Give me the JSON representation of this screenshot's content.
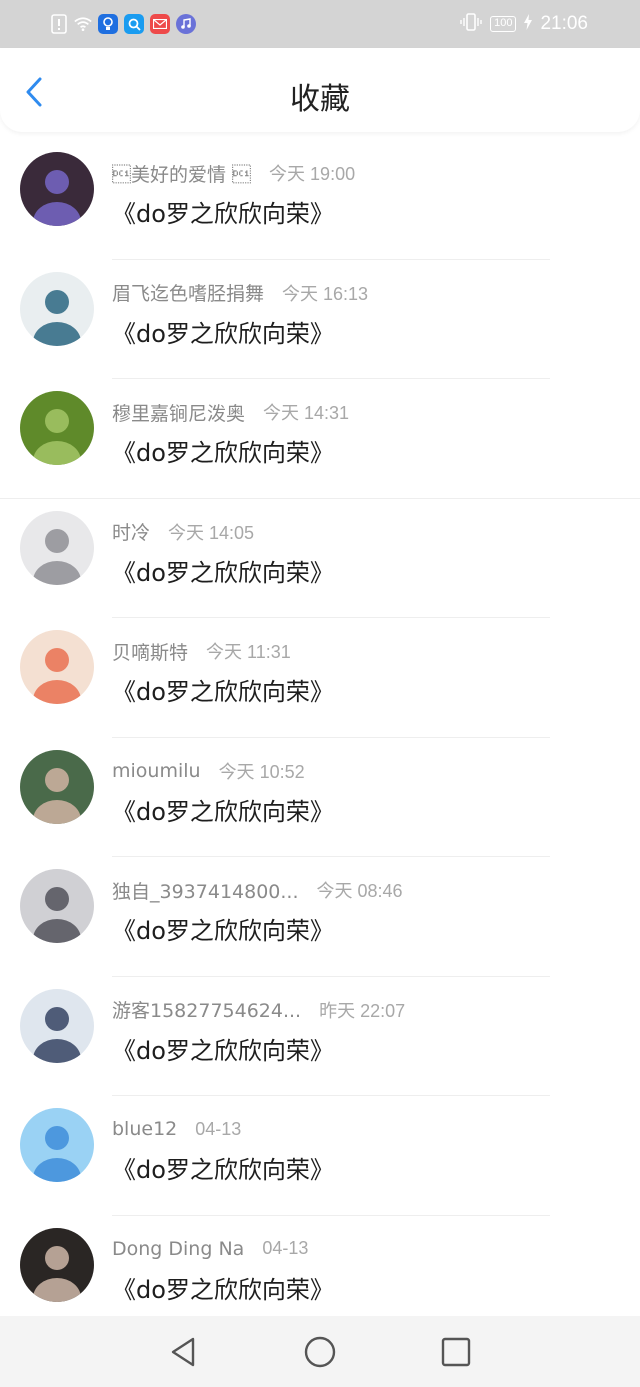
{
  "status_bar": {
    "time": "21:06",
    "battery": "100",
    "left_icons": [
      "alert-icon",
      "wifi-icon",
      "bulb-app-icon",
      "search-app-icon",
      "huawei-mail-icon",
      "music-app-icon"
    ],
    "right_icons": [
      "vibrate-icon",
      "battery-icon",
      "charging-icon"
    ]
  },
  "header": {
    "title": "收藏",
    "back_icon": "chevron-left-icon",
    "accent": "#2f8bef"
  },
  "favorites": [
    {
      "name": "\u0011美好的爱情 \u0011",
      "time": "今天 19:00",
      "content": "《do罗之欣欣向荣》",
      "avatar": [
        "#3a2a3a",
        "#7a6ad0"
      ]
    },
    {
      "name": "眉飞迄色嗜胫捐舞",
      "time": "今天 16:13",
      "content": "《do罗之欣欣向荣》",
      "avatar": [
        "#e9eef0",
        "#1f5e7a"
      ]
    },
    {
      "name": "穆里嘉锏尼泼奥",
      "time": "今天 14:31",
      "content": "《do罗之欣欣向荣》",
      "avatar": [
        "#5f8a2a",
        "#a8c86a"
      ]
    },
    {
      "name": "时冷",
      "time": "今天 14:05",
      "content": "《do罗之欣欣向荣》",
      "avatar": [
        "#e8e8ea",
        "#8a8a90"
      ]
    },
    {
      "name": "贝嘀斯特",
      "time": "今天 11:31",
      "content": "《do罗之欣欣向荣》",
      "avatar": [
        "#f4e0d2",
        "#e86a4a"
      ]
    },
    {
      "name": "mioumilu",
      "time": "今天 10:52",
      "content": "《do罗之欣欣向荣》",
      "avatar": [
        "#4a6a4a",
        "#d8b8a8"
      ]
    },
    {
      "name": "独自_3937414800...",
      "time": "今天 08:46",
      "content": "《do罗之欣欣向荣》",
      "avatar": [
        "#d0d0d4",
        "#4a4a52"
      ]
    },
    {
      "name": "游客15827754624...",
      "time": "昨天 22:07",
      "content": "《do罗之欣欣向荣》",
      "avatar": [
        "#dfe6ee",
        "#2a3a5a"
      ]
    },
    {
      "name": "blue12",
      "time": "04-13",
      "content": "《do罗之欣欣向荣》",
      "avatar": [
        "#9ad2f4",
        "#3a8ad8"
      ]
    },
    {
      "name": "Dong Ding Na",
      "time": "04-13",
      "content": "《do罗之欣欣向荣》",
      "avatar": [
        "#2a2624",
        "#d8c0b0"
      ]
    }
  ],
  "nav_bar": {
    "back_icon": "triangle-back-icon",
    "home_icon": "circle-home-icon",
    "recents_icon": "square-recents-icon"
  }
}
